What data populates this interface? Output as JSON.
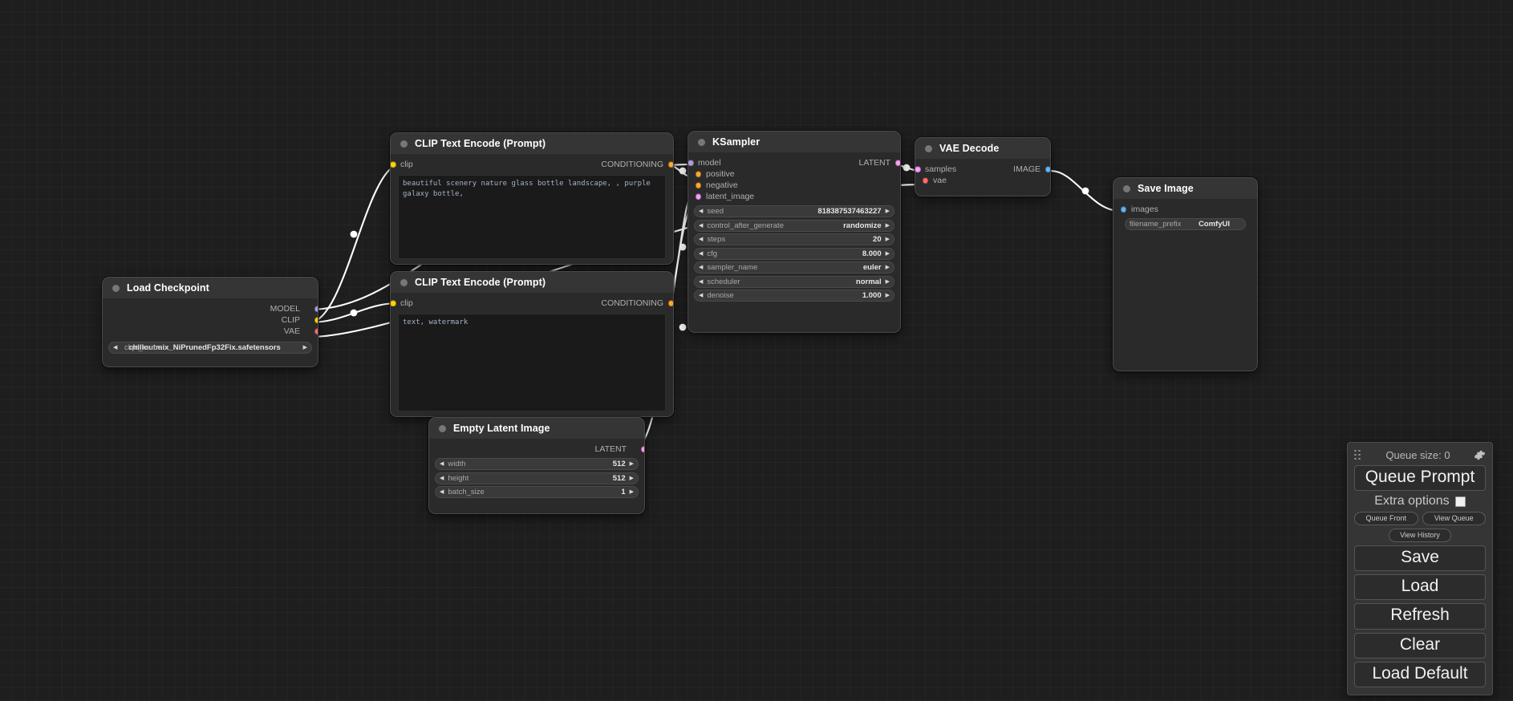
{
  "app": {
    "name": "ComfyUI",
    "canvas_background": "#1e1e1e"
  },
  "port_colors": {
    "MODEL": "#b39ddb",
    "CLIP": "#ffd500",
    "VAE": "#ff6e6e",
    "CONDITIONING": "#ffa931",
    "LATENT": "#ff9cf9",
    "IMAGE": "#64b5f6"
  },
  "nodes": [
    {
      "id": "load-checkpoint",
      "title": "Load Checkpoint",
      "outputs": [
        {
          "label": "MODEL",
          "color": "#b39ddb"
        },
        {
          "label": "CLIP",
          "color": "#ffd500"
        },
        {
          "label": "VAE",
          "color": "#ff6e6e"
        }
      ],
      "widgets": [
        {
          "name": "ckpt_name",
          "value": "chilloutmix_NiPrunedFp32Fix.safetensors",
          "type": "combo"
        }
      ]
    },
    {
      "id": "clip-text-encode-positive",
      "title": "CLIP Text Encode (Prompt)",
      "inputs": [
        {
          "label": "clip",
          "color": "#ffd500"
        }
      ],
      "outputs": [
        {
          "label": "CONDITIONING",
          "color": "#ffa931"
        }
      ],
      "text": "beautiful scenery nature glass bottle landscape, , purple galaxy bottle,"
    },
    {
      "id": "clip-text-encode-negative",
      "title": "CLIP Text Encode (Prompt)",
      "inputs": [
        {
          "label": "clip",
          "color": "#ffd500"
        }
      ],
      "outputs": [
        {
          "label": "CONDITIONING",
          "color": "#ffa931"
        }
      ],
      "text": "text, watermark"
    },
    {
      "id": "ksampler",
      "title": "KSampler",
      "inputs": [
        {
          "label": "model",
          "color": "#b39ddb"
        },
        {
          "label": "positive",
          "color": "#ffa931"
        },
        {
          "label": "negative",
          "color": "#ffa931"
        },
        {
          "label": "latent_image",
          "color": "#ff9cf9"
        }
      ],
      "outputs": [
        {
          "label": "LATENT",
          "color": "#ff9cf9"
        }
      ],
      "widgets": [
        {
          "name": "seed",
          "value": "818387537463227",
          "type": "number"
        },
        {
          "name": "control_after_generate",
          "value": "randomize",
          "type": "combo"
        },
        {
          "name": "steps",
          "value": "20",
          "type": "number"
        },
        {
          "name": "cfg",
          "value": "8.000",
          "type": "number"
        },
        {
          "name": "sampler_name",
          "value": "euler",
          "type": "combo"
        },
        {
          "name": "scheduler",
          "value": "normal",
          "type": "combo"
        },
        {
          "name": "denoise",
          "value": "1.000",
          "type": "number"
        }
      ]
    },
    {
      "id": "empty-latent-image",
      "title": "Empty Latent Image",
      "outputs": [
        {
          "label": "LATENT",
          "color": "#ff9cf9"
        }
      ],
      "widgets": [
        {
          "name": "width",
          "value": "512",
          "type": "number"
        },
        {
          "name": "height",
          "value": "512",
          "type": "number"
        },
        {
          "name": "batch_size",
          "value": "1",
          "type": "number"
        }
      ]
    },
    {
      "id": "vae-decode",
      "title": "VAE Decode",
      "inputs": [
        {
          "label": "samples",
          "color": "#ff9cf9"
        },
        {
          "label": "vae",
          "color": "#ff6e6e"
        }
      ],
      "outputs": [
        {
          "label": "IMAGE",
          "color": "#64b5f6"
        }
      ]
    },
    {
      "id": "save-image",
      "title": "Save Image",
      "inputs": [
        {
          "label": "images",
          "color": "#64b5f6"
        }
      ],
      "widgets": [
        {
          "name": "filename_prefix",
          "value": "ComfyUI",
          "type": "text"
        }
      ]
    }
  ],
  "panel": {
    "queue_size_label": "Queue size: 0",
    "queue_prompt_label": "Queue Prompt",
    "extra_options_label": "Extra options",
    "extra_options_checked": false,
    "queue_front_label": "Queue Front",
    "view_queue_label": "View Queue",
    "view_history_label": "View History",
    "save_label": "Save",
    "load_label": "Load",
    "refresh_label": "Refresh",
    "clear_label": "Clear",
    "load_default_label": "Load Default"
  }
}
